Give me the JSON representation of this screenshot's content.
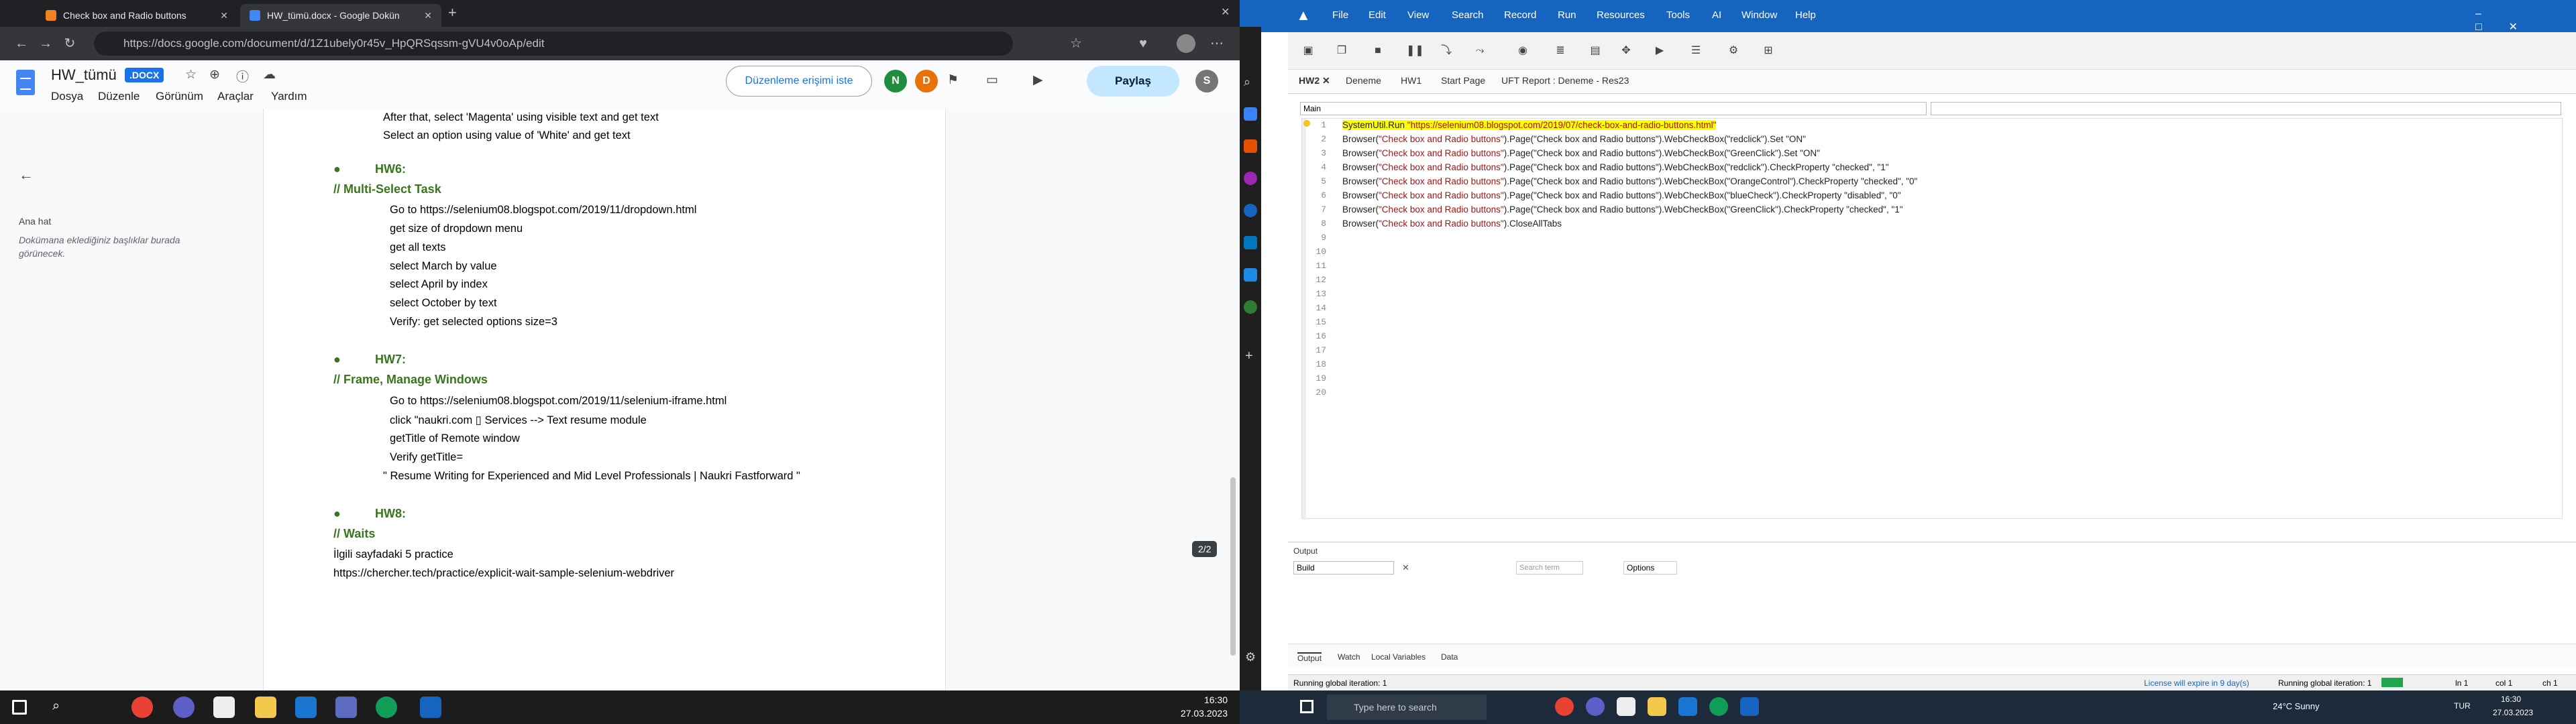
{
  "browser": {
    "tabs": [
      {
        "label": "Check box and Radio buttons",
        "color": "#f48120"
      },
      {
        "label": "HW_tümü.docx - Google Dokün",
        "color": "#4285f4"
      }
    ],
    "url": "https://docs.google.com/document/d/1Z1ubely0r45v_HpQRSqssm-gVU4v0oAp/edit"
  },
  "docs": {
    "title": "HW_tümü",
    "badge": ".DOCX",
    "menus": [
      "Dosya",
      "Düzenle",
      "Görünüm",
      "Araçlar",
      "Yardım"
    ],
    "edit_access": "Düzenleme erişimi iste",
    "avatars": [
      "N",
      "D",
      "S"
    ],
    "share": "Paylaş",
    "outline_title": "Ana hat",
    "outline_hint": "Dokümana eklediğiniz başlıklar burada görünecek.",
    "page_badge": "2/2",
    "lines": {
      "l1": "After that, select 'Magenta' using visible text and get text",
      "l2": "Select an option using value of 'White' and get text",
      "hw6": "HW6:",
      "hw6_sub": "// Multi-Select Task",
      "l3": "Go to https://selenium08.blogspot.com/2019/11/dropdown.html",
      "l4": "get size of dropdown menu",
      "l5": "get all texts",
      "l6": "select March by value",
      "l7": "select April by index",
      "l8": "select October by text",
      "l9": "Verify: get selected options size=3",
      "hw7": "HW7:",
      "hw7_sub": "// Frame, Manage Windows",
      "l10": "Go to https://selenium08.blogspot.com/2019/11/selenium-iframe.html",
      "l11": "click \"naukri.com ▯ Services --> Text resume module",
      "l12": "getTitle of Remote window",
      "l13": "Verify getTitle=",
      "l14": "\" Resume Writing for Experienced and Mid Level Professionals | Naukri Fastforward \"",
      "hw8": "HW8:",
      "hw8_sub": "// Waits",
      "l15": "İlgili sayfadaki 5 practice",
      "l16": "https://chercher.tech/practice/explicit-wait-sample-selenium-webdriver"
    }
  },
  "taskbar_left": {
    "time": "16:30",
    "date": "27.03.2023"
  },
  "uft": {
    "menus": [
      "File",
      "Edit",
      "View",
      "Search",
      "Record",
      "Run",
      "Resources",
      "Tools",
      "AI",
      "Window",
      "Help"
    ],
    "tabs": [
      "HW2",
      "Deneme",
      "HW1",
      "Start Page",
      "UFT Report : Deneme - Res23"
    ],
    "action": "Main",
    "code": [
      [
        "SystemUtil.Run ",
        "\"https://selenium08.blogspot.com/2019/07/check-box-and-radio-buttons.html\"",
        ""
      ],
      [
        "Browser(",
        "\"Check box and Radio buttons\"",
        ").Page(\"Check box and Radio buttons\").WebCheckBox(\"redclick\").Set \"ON\""
      ],
      [
        "Browser(",
        "\"Check box and Radio buttons\"",
        ").Page(\"Check box and Radio buttons\").WebCheckBox(\"GreenClick\").Set \"ON\""
      ],
      [
        "Browser(",
        "\"Check box and Radio buttons\"",
        ").Page(\"Check box and Radio buttons\").WebCheckBox(\"redclick\").CheckProperty \"checked\", \"1\""
      ],
      [
        "Browser(",
        "\"Check box and Radio buttons\"",
        ").Page(\"Check box and Radio buttons\").WebCheckBox(\"OrangeControl\").CheckProperty \"checked\", \"0\""
      ],
      [
        "Browser(",
        "\"Check box and Radio buttons\"",
        ").Page(\"Check box and Radio buttons\").WebCheckBox(\"blueCheck\").CheckProperty \"disabled\", \"0\""
      ],
      [
        "Browser(",
        "\"Check box and Radio buttons\"",
        ").Page(\"Check box and Radio buttons\").WebCheckBox(\"GreenClick\").CheckProperty \"checked\", \"1\""
      ],
      [
        "Browser(",
        "\"Check box and Radio buttons\"",
        ").CloseAllTabs"
      ]
    ],
    "line_count": 20,
    "output": {
      "title": "Output",
      "build": "Build",
      "search_placeholder": "Search term",
      "options": "Options"
    },
    "bottom_tabs": [
      "Output",
      "Watch",
      "Local Variables",
      "Data"
    ],
    "status": {
      "left": "Running global iteration: 1",
      "license": "License will expire in 9 day(s)",
      "iteration": "Running global iteration: 1",
      "ln": "ln 1",
      "col": "col 1",
      "ch": "ch 1"
    }
  },
  "taskbar_right": {
    "search": "Type here to search",
    "weather": "24°C  Sunny",
    "lang": "TUR",
    "time": "16:30",
    "date": "27.03.2023"
  }
}
